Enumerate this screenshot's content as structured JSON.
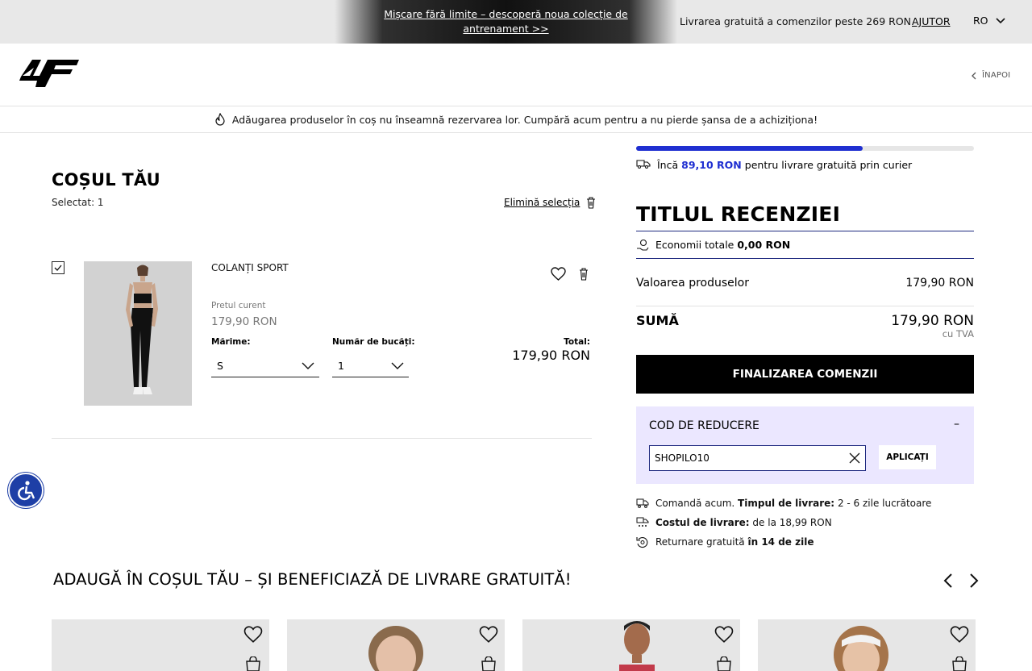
{
  "topbar": {
    "promo_line1": "Mișcare fără limite – descoperă noua colecție de",
    "promo_line2": "antrenament >>",
    "shipping": "Livrarea gratuită a comenzilor peste 269 RON",
    "help": "AJUTOR",
    "language": "RO"
  },
  "header": {
    "logo_text": "4F",
    "back_label": "ÎNAPOI"
  },
  "notice": "Adăugarea produselor în coș nu înseamnă rezervarea lor. Cumpără acum pentru a nu pierde șansa de a achiziționa!",
  "cart": {
    "title": "COȘUL TĂU",
    "selected": "Selectat: 1",
    "remove_selection": "Elimină selecția",
    "item": {
      "checked": true,
      "name": "COLANȚI SPORT",
      "price_label": "Pretul curent",
      "price": "179,90 RON",
      "size_label": "Mărime:",
      "size_value": "S",
      "qty_label": "Număr de bucăți:",
      "qty_value": "1",
      "total_label": "Total:",
      "total_value": "179,90 RON"
    }
  },
  "summary": {
    "progress_fraction": 0.67,
    "free_ship_prefix": "Încă",
    "free_ship_amount": "89,10 RON",
    "free_ship_suffix": "pentru livrare gratuită prin curier",
    "title": "TITLUL RECENZIEI",
    "savings_label": "Economii totale",
    "savings_value": "0,00 RON",
    "products_label": "Valoarea produselor",
    "products_value": "179,90 RON",
    "sum_label": "SUMĂ",
    "sum_value": "179,90 RON",
    "vat": "cu TVA",
    "checkout": "FINALIZAREA COMENZII",
    "coupon": {
      "title": "COD DE REDUCERE",
      "toggle": "–",
      "value": "SHOPILO10",
      "apply": "APLICAȚI"
    },
    "info": [
      {
        "text": "Comandă acum.",
        "bold": "Timpul de livrare:",
        "rest": "2 - 6 zile lucrătoare"
      },
      {
        "text": "",
        "bold": "Costul de livrare:",
        "rest": "de la 18,99 RON"
      },
      {
        "text": "Returnare gratuită",
        "bold": "în 14 de zile",
        "rest": ""
      }
    ]
  },
  "recommendations": {
    "title": "ADAUGĂ ÎN COȘUL TĂU – ȘI BENEFICIAZĂ DE LIVRARE GRATUITĂ!"
  },
  "colors": {
    "accent_blue": "#1f2fd1",
    "coupon_bg": "#ebe7ff",
    "a11y_blue": "#1e3fa6"
  }
}
